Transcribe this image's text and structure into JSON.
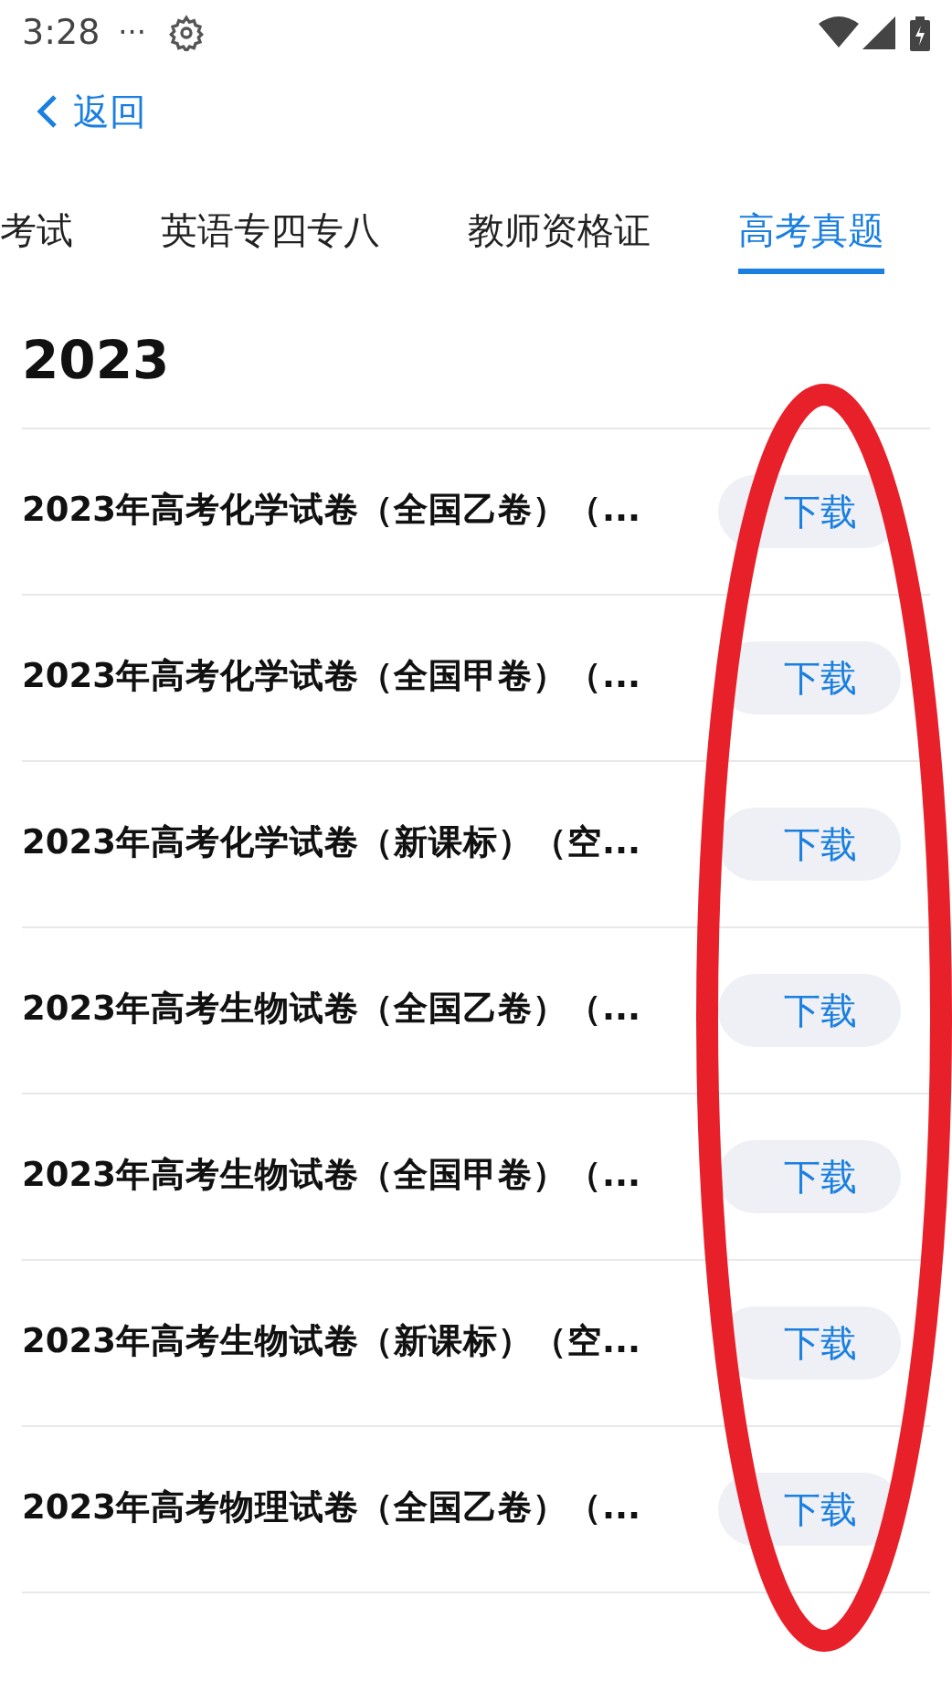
{
  "status_bar": {
    "time": "3:28",
    "more": "···"
  },
  "back": {
    "label": "返回"
  },
  "tabs": [
    {
      "label": "考试",
      "selected": false
    },
    {
      "label": "英语专四专八",
      "selected": false
    },
    {
      "label": "教师资格证",
      "selected": false
    },
    {
      "label": "高考真题",
      "selected": true
    }
  ],
  "section": {
    "title": "2023"
  },
  "items": [
    {
      "title": "2023年高考化学试卷（全国乙卷）（...",
      "button": "下载"
    },
    {
      "title": "2023年高考化学试卷（全国甲卷）（...",
      "button": "下载"
    },
    {
      "title": "2023年高考化学试卷（新课标）（空...",
      "button": "下载"
    },
    {
      "title": "2023年高考生物试卷（全国乙卷）（...",
      "button": "下载"
    },
    {
      "title": "2023年高考生物试卷（全国甲卷）（...",
      "button": "下载"
    },
    {
      "title": "2023年高考生物试卷（新课标）（空...",
      "button": "下载"
    },
    {
      "title": "2023年高考物理试卷（全国乙卷）（...",
      "button": "下载"
    }
  ]
}
